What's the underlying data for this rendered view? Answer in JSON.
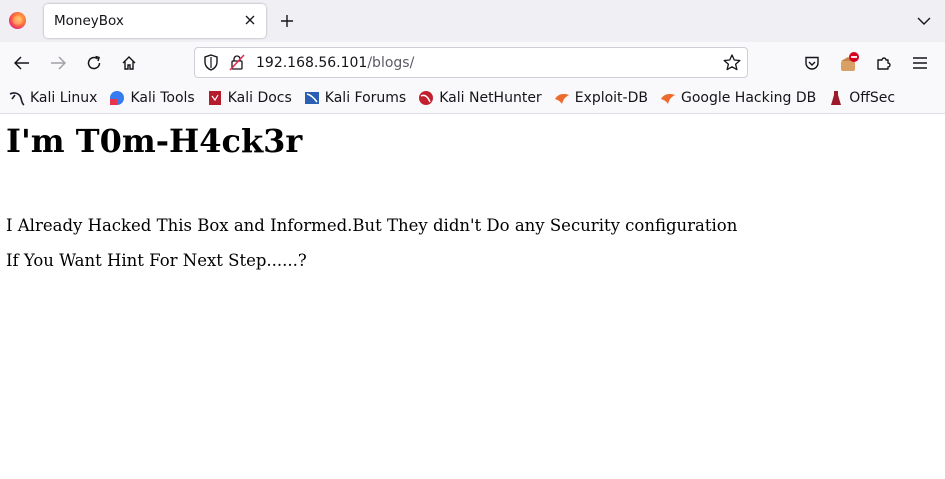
{
  "browser": {
    "tab": {
      "title": "MoneyBox"
    },
    "url": {
      "host": "192.168.56.101",
      "path": "/blogs/"
    },
    "bookmarks": [
      {
        "label": "Kali Linux",
        "icon": "kali-dragon-icon"
      },
      {
        "label": "Kali Tools",
        "icon": "kali-tools-icon"
      },
      {
        "label": "Kali Docs",
        "icon": "kali-docs-icon"
      },
      {
        "label": "Kali Forums",
        "icon": "kali-forums-icon"
      },
      {
        "label": "Kali NetHunter",
        "icon": "kali-nethunter-icon"
      },
      {
        "label": "Exploit-DB",
        "icon": "exploit-db-icon"
      },
      {
        "label": "Google Hacking DB",
        "icon": "ghdb-icon"
      },
      {
        "label": "OffSec",
        "icon": "offsec-icon"
      }
    ],
    "colors": {
      "accent": "#0060df",
      "toolbar": "#f9f9fb",
      "tabstrip": "#f0f0f4"
    }
  },
  "page": {
    "heading": "I'm T0m-H4ck3r",
    "paragraphs": [
      "I Already Hacked This Box and Informed.But They didn't Do any Security configuration",
      "If You Want Hint For Next Step......?"
    ]
  }
}
